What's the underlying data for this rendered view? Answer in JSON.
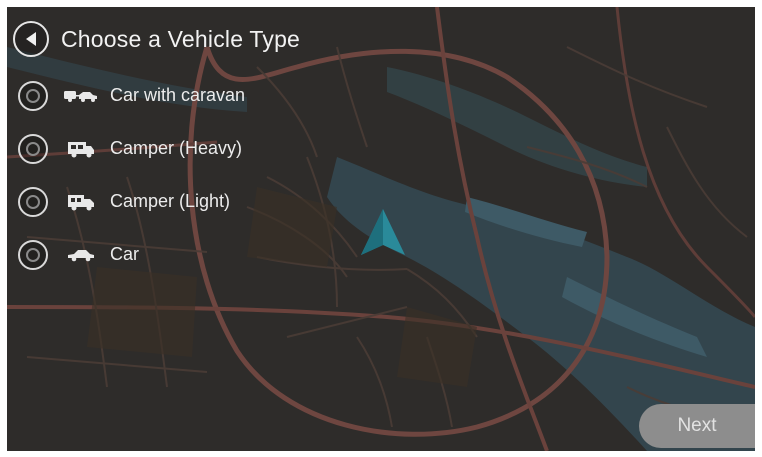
{
  "header": {
    "title": "Choose a Vehicle Type",
    "back_icon": "back-arrow-icon"
  },
  "options": [
    {
      "label": "Car with caravan",
      "icon": "car-with-caravan-icon",
      "selected": false
    },
    {
      "label": "Camper (Heavy)",
      "icon": "camper-heavy-icon",
      "selected": false
    },
    {
      "label": "Camper (Light)",
      "icon": "camper-light-icon",
      "selected": false
    },
    {
      "label": "Car",
      "icon": "car-icon",
      "selected": false
    }
  ],
  "footer": {
    "next_label": "Next"
  },
  "colors": {
    "map_background": "#2e2c2a",
    "road": "#6e4640",
    "water": "#3f5a66",
    "position_arrow": "#2a8a9a",
    "next_button": "#8d8d8d"
  }
}
